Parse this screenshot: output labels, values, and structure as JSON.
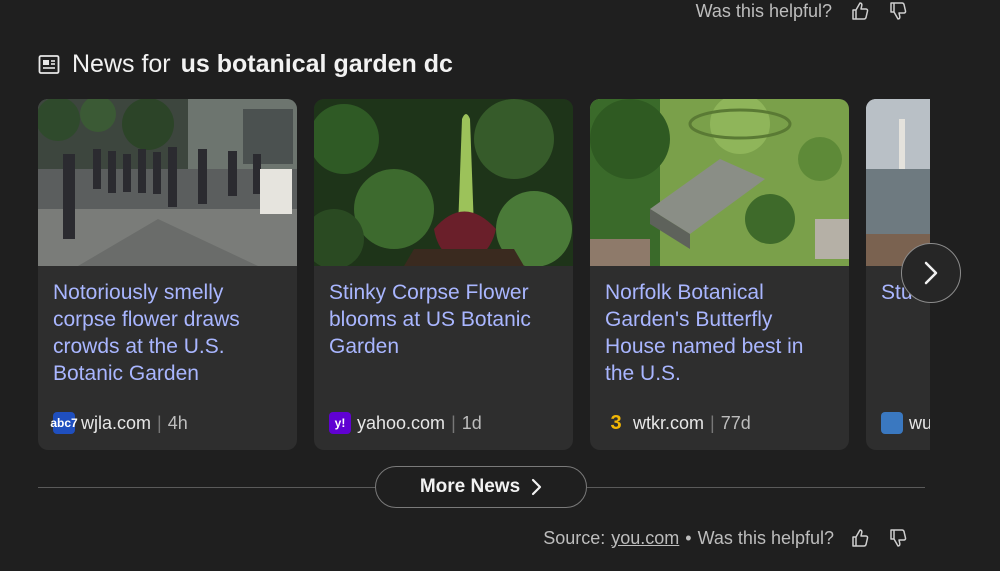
{
  "top_feedback": {
    "question": "Was this helpful?"
  },
  "news_section": {
    "prefix": "News for",
    "query": "us botanical garden dc"
  },
  "cards": [
    {
      "title": "Notoriously smelly corpse flower draws crowds at the U.S. Botanic Garden",
      "source": "wjla.com",
      "age": "4h",
      "logo_text": "abc7"
    },
    {
      "title": "Stinky Corpse Flower blooms at US Botanic Garden",
      "source": "yahoo.com",
      "age": "1d",
      "logo_text": "y!"
    },
    {
      "title": "Norfolk Botanical Garden's Butterfly House named best in the U.S.",
      "source": "wtkr.com",
      "age": "77d",
      "logo_text": "3"
    },
    {
      "title": "Stu… proud… a few…",
      "source": "wu…",
      "age": "",
      "logo_text": ""
    }
  ],
  "more_news": {
    "label": "More News"
  },
  "bottom_feedback": {
    "source_label": "Source:",
    "source_link": "you.com",
    "bullet": "•",
    "question": "Was this helpful?"
  },
  "colors": {
    "background": "#1f1f1f",
    "card": "#2e2e2e",
    "title_link": "#a9b6ff",
    "yahoo_purple": "#6001d2",
    "wtkr_yellow": "#f2b705",
    "wjla_blue": "#1f4fbf"
  },
  "icons": [
    "newspaper-icon",
    "thumbs-up-icon",
    "thumbs-down-icon",
    "chevron-right-icon"
  ]
}
